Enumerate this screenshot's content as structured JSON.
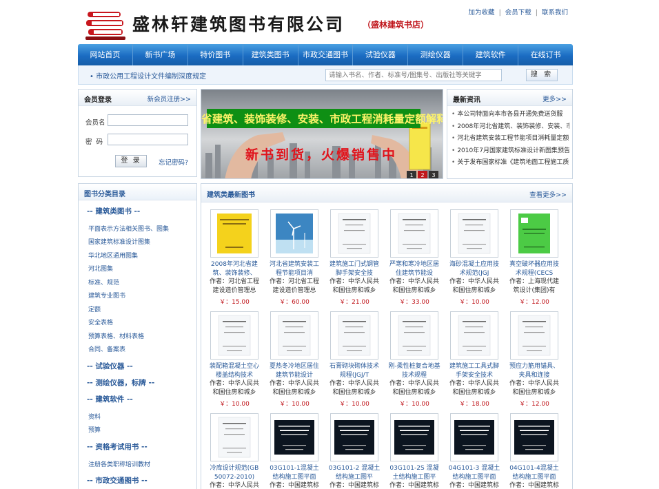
{
  "header": {
    "company_name": "盛林轩建筑图书有限公司",
    "company_sub": "（盛林建筑书店）",
    "links": [
      "加为收藏",
      "会员下载",
      "联系我们"
    ]
  },
  "nav": {
    "items": [
      "网站首页",
      "新书广场",
      "特价图书",
      "建筑类图书",
      "市政交通图书",
      "试验仪器",
      "测绘仪器",
      "建筑软件",
      "在线订书"
    ]
  },
  "subbar": {
    "notice": "• 市政公用工程设计文件编制深度规定",
    "search_placeholder": "请输入书名、作者、标准号/图集号、出版社等关键字",
    "search_button": "搜 索"
  },
  "login": {
    "title": "会员登录",
    "register": "新会员注册>>",
    "username_label": "会员名",
    "password_label": "密  码",
    "login_button": "登 录",
    "forgot": "忘记密码?"
  },
  "banner": {
    "headline": "河北省建筑、装饰装修、安装、市政工程消耗量定额解释",
    "slogan": "新书到货，火爆销售中",
    "slides": [
      "1",
      "2",
      "3"
    ]
  },
  "news": {
    "title": "最新资讯",
    "more": "更多>>",
    "items": [
      "本公司特面向本市各县开通免费送货服",
      "2008年河北省建筑、装饰装修、安装、市",
      "河北省建筑安装工程节能项目消耗量定额",
      "2010年7月国家建筑标准设计新图集预告",
      "关于发布国家标准《建筑地面工程施工质"
    ]
  },
  "categories": {
    "title": "图书分类目录",
    "groups": [
      {
        "name": "-- 建筑类图书 --",
        "items": [
          "平面表示方法相关图书、图集",
          "国家建筑标准设计图集",
          "华北地区通用图集",
          "河北图集",
          "标准、规范",
          "建筑专业图书",
          "定额",
          "安全表格",
          "预算表格、材料表格",
          "合同、备案表"
        ]
      },
      {
        "name": "-- 试验仪器 --",
        "items": []
      },
      {
        "name": "-- 测绘仪器，标牌 --",
        "items": []
      },
      {
        "name": "-- 建筑软件 --",
        "items": [
          "资料",
          "预算"
        ]
      },
      {
        "name": "-- 资格考试用书 --",
        "items": [
          "注册各类职称培训教材"
        ]
      },
      {
        "name": "-- 市政交通图书 --",
        "items": []
      }
    ]
  },
  "books": {
    "title": "建筑类最新图书",
    "more": "查看更多>>",
    "author_prefix": "作者：",
    "items": [
      {
        "title": "2008年河北省建筑、装饰装修、",
        "author": "作者：河北省工程建设造价管理总",
        "price": "￥：15.00",
        "cover": "yellow"
      },
      {
        "title": "河北省建筑安装工程节能项目消",
        "author": "作者：河北省工程建设造价管理总",
        "price": "￥：60.00",
        "cover": "windmill"
      },
      {
        "title": "建筑施工门式钢管脚手架安全技",
        "author": "作者：中华人民共和国住房和城乡",
        "price": "￥：21.00",
        "cover": "white"
      },
      {
        "title": "严寒和寒冷地区居住建筑节能设",
        "author": "作者：中华人民共和国住房和城乡",
        "price": "￥：33.00",
        "cover": "white"
      },
      {
        "title": "海砂混凝土应用技术规范(JGJ",
        "author": "作者：中华人民共和国住房和城乡",
        "price": "￥：10.00",
        "cover": "white"
      },
      {
        "title": "真空破坏器应用技术规程(CECS",
        "author": "作者：上海现代建筑设计(集团)有",
        "price": "￥：12.00",
        "cover": "green"
      },
      {
        "title": "装配箱混凝土空心楼盖结构技术",
        "author": "作者：中华人民共和国住房和城乡",
        "price": "￥：10.00",
        "cover": "white"
      },
      {
        "title": "夏热冬冷地区居住建筑节能设计",
        "author": "作者：中华人民共和国住房和城乡",
        "price": "￥：10.00",
        "cover": "white"
      },
      {
        "title": "石膏砌块砌体技术规程(JGJ/T",
        "author": "作者：中华人民共和国住房和城乡",
        "price": "￥：10.00",
        "cover": "white"
      },
      {
        "title": "刚-柔性桩复合地基技术规程",
        "author": "作者：中华人民共和国住房和城乡",
        "price": "￥：10.00",
        "cover": "white"
      },
      {
        "title": "建筑施工工具式脚手架安全技术",
        "author": "作者：中华人民共和国住房和城乡",
        "price": "￥：18.00",
        "cover": "white"
      },
      {
        "title": "预应力筋用锚具、夹具和连接",
        "author": "作者：中华人民共和国住房和城乡",
        "price": "￥：12.00",
        "cover": "white"
      },
      {
        "title": "冷库设计规范(GB 50072-2010)",
        "author": "作者：中华人民共",
        "price": "",
        "cover": "white"
      },
      {
        "title": "03G101-1混凝土结构施工图平面",
        "author": "作者：中国建筑标",
        "price": "",
        "cover": "dark"
      },
      {
        "title": "03G101-2 混凝土结构施工图平",
        "author": "作者：中国建筑标",
        "price": "",
        "cover": "dark"
      },
      {
        "title": "03G101-2S 混凝土结构施工图平",
        "author": "作者：中国建筑标",
        "price": "",
        "cover": "dark"
      },
      {
        "title": "04G101-3 混凝土结构施工图平面",
        "author": "作者：中国建筑标",
        "price": "",
        "cover": "dark"
      },
      {
        "title": "04G101-4混凝土结构施工图平面",
        "author": "作者：中国建筑标",
        "price": "",
        "cover": "dark"
      }
    ]
  },
  "colors": {
    "nav_blue": "#1b6cc2",
    "link_blue": "#2a5a99",
    "price_red": "#c0161c"
  },
  "icons": {
    "logo": "book-stack-icon",
    "notice_bullet": "bullet-icon"
  }
}
